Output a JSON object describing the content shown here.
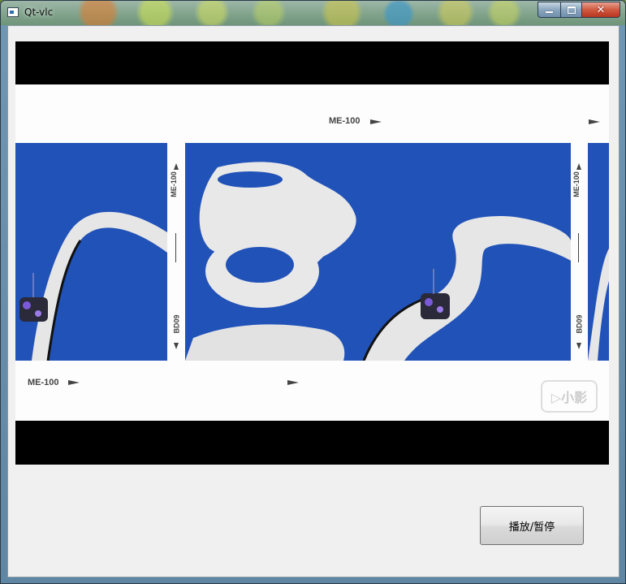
{
  "window": {
    "title": "Qt-vlc"
  },
  "video_overlay": {
    "track_label": "ME-100",
    "side_label": "BD09",
    "watermark": "▷小影"
  },
  "controls": {
    "play_pause_label": "播放/暂停"
  }
}
